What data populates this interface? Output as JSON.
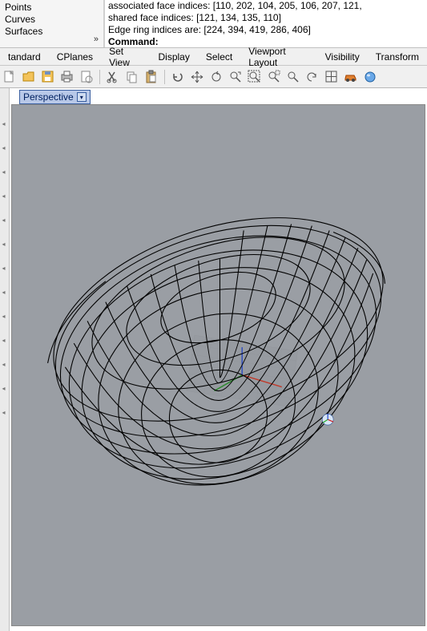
{
  "tree": {
    "points": "Points",
    "curves": "Curves",
    "surfaces": "Surfaces"
  },
  "cmd": {
    "line0": "associated face indices: [110, 202, 104, 205, 106, 207, 121,",
    "line1": "shared face indices: [121, 134, 135, 110]",
    "line2": "Edge ring indices are: [224, 394, 419, 286, 406]",
    "prompt_label": "Command:",
    "prompt_value": ""
  },
  "menu": {
    "standard": "tandard",
    "cplanes": "CPlanes",
    "setview": "Set View",
    "display": "Display",
    "select": "Select",
    "vplayout": "Viewport Layout",
    "visibility": "Visibility",
    "transform": "Transform"
  },
  "viewport": {
    "title": "Perspective"
  }
}
